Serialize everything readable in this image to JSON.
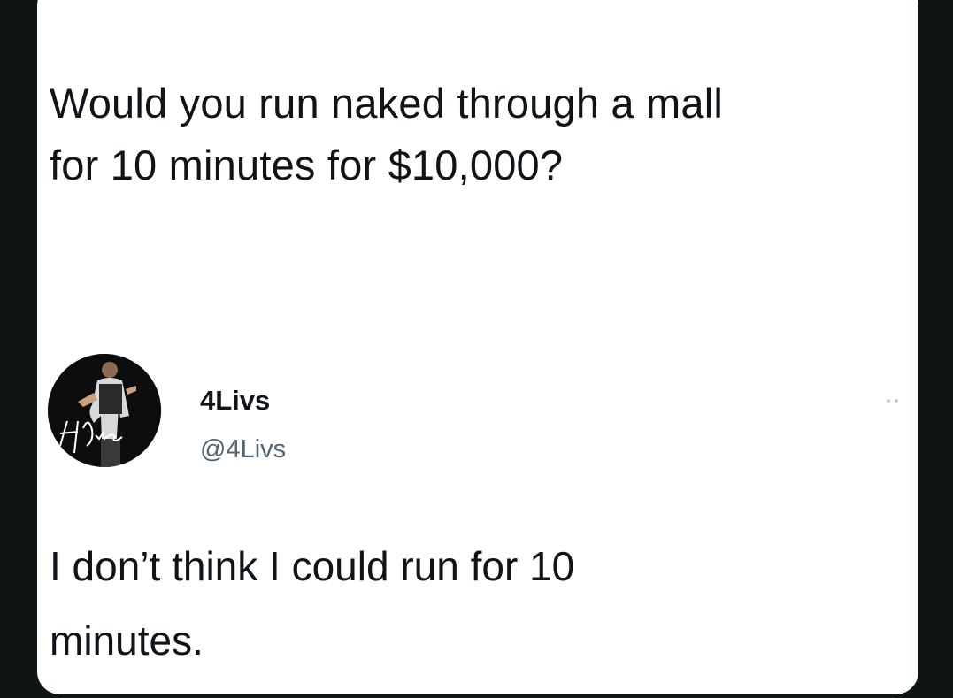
{
  "tweet": {
    "text_lines": [
      "Would you run naked through a mall",
      "for 10 minutes for $10,000?"
    ]
  },
  "reply": {
    "author": {
      "name": "4Livs",
      "handle": "@4Livs",
      "avatar_signature": "4Livs"
    },
    "text_lines": [
      "I don’t think I could run for 10",
      "minutes."
    ]
  },
  "icons": {
    "more": "more-dots-icon"
  },
  "colors": {
    "background": "#0f1414",
    "card": "#ffffff",
    "text_primary": "#0f1419",
    "text_secondary": "#536471"
  }
}
